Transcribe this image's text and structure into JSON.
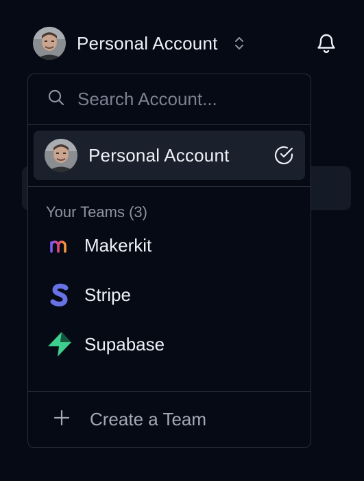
{
  "header": {
    "account_label": "Personal Account",
    "avatar_icon": "user-avatar",
    "switcher_icon": "chevrons-up-down-icon",
    "notifications_icon": "bell-icon"
  },
  "account_menu": {
    "search": {
      "placeholder": "Search Account...",
      "value": "",
      "icon": "search-icon"
    },
    "selected_account": {
      "label": "Personal Account",
      "status_icon": "check-circle-icon"
    },
    "teams_heading": "Your Teams (3)",
    "teams": [
      {
        "name": "Makerkit",
        "icon": "makerkit-logo",
        "color": "#d64f7c"
      },
      {
        "name": "Stripe",
        "icon": "stripe-logo",
        "color": "#6772e5"
      },
      {
        "name": "Supabase",
        "icon": "supabase-logo",
        "color": "#3ecf8e"
      }
    ],
    "create_team": {
      "label": "Create a Team",
      "icon": "plus-icon"
    }
  },
  "colors": {
    "background": "#050a15",
    "border": "#2a2f3b",
    "selected_row": "#1a202c",
    "muted_text": "#8d93a1"
  }
}
